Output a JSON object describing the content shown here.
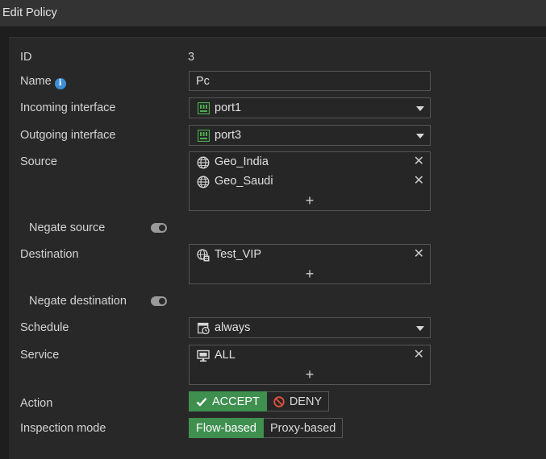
{
  "window": {
    "title": "Edit Policy"
  },
  "form": {
    "id": {
      "label": "ID",
      "value": "3"
    },
    "name": {
      "label": "Name",
      "value": "Pc"
    },
    "incoming": {
      "label": "Incoming interface",
      "value": "port1",
      "icon": "port-icon"
    },
    "outgoing": {
      "label": "Outgoing interface",
      "value": "port3",
      "icon": "port-icon"
    },
    "source": {
      "label": "Source",
      "items": [
        {
          "label": "Geo_India",
          "icon": "globe-icon"
        },
        {
          "label": "Geo_Saudi",
          "icon": "globe-icon"
        }
      ],
      "add": "+"
    },
    "negate_source": {
      "label": "Negate source",
      "on": false
    },
    "destination": {
      "label": "Destination",
      "items": [
        {
          "label": "Test_VIP",
          "icon": "vip-globe-icon"
        }
      ],
      "add": "+"
    },
    "negate_destination": {
      "label": "Negate destination",
      "on": false
    },
    "schedule": {
      "label": "Schedule",
      "value": "always",
      "icon": "clock-calendar-icon"
    },
    "service": {
      "label": "Service",
      "items": [
        {
          "label": "ALL",
          "icon": "service-monitor-icon"
        }
      ],
      "add": "+"
    },
    "action": {
      "label": "Action",
      "options": [
        {
          "label": "ACCEPT",
          "icon": "check-icon",
          "active": true
        },
        {
          "label": "DENY",
          "icon": "deny-icon",
          "active": false
        }
      ]
    },
    "inspection": {
      "label": "Inspection mode",
      "options": [
        {
          "label": "Flow-based",
          "active": true
        },
        {
          "label": "Proxy-based",
          "active": false
        }
      ]
    }
  },
  "colors": {
    "accent_green": "#3f8f4f",
    "info_blue": "#3d8fd6",
    "port_green": "#4caf50",
    "deny_red": "#e0533d"
  }
}
